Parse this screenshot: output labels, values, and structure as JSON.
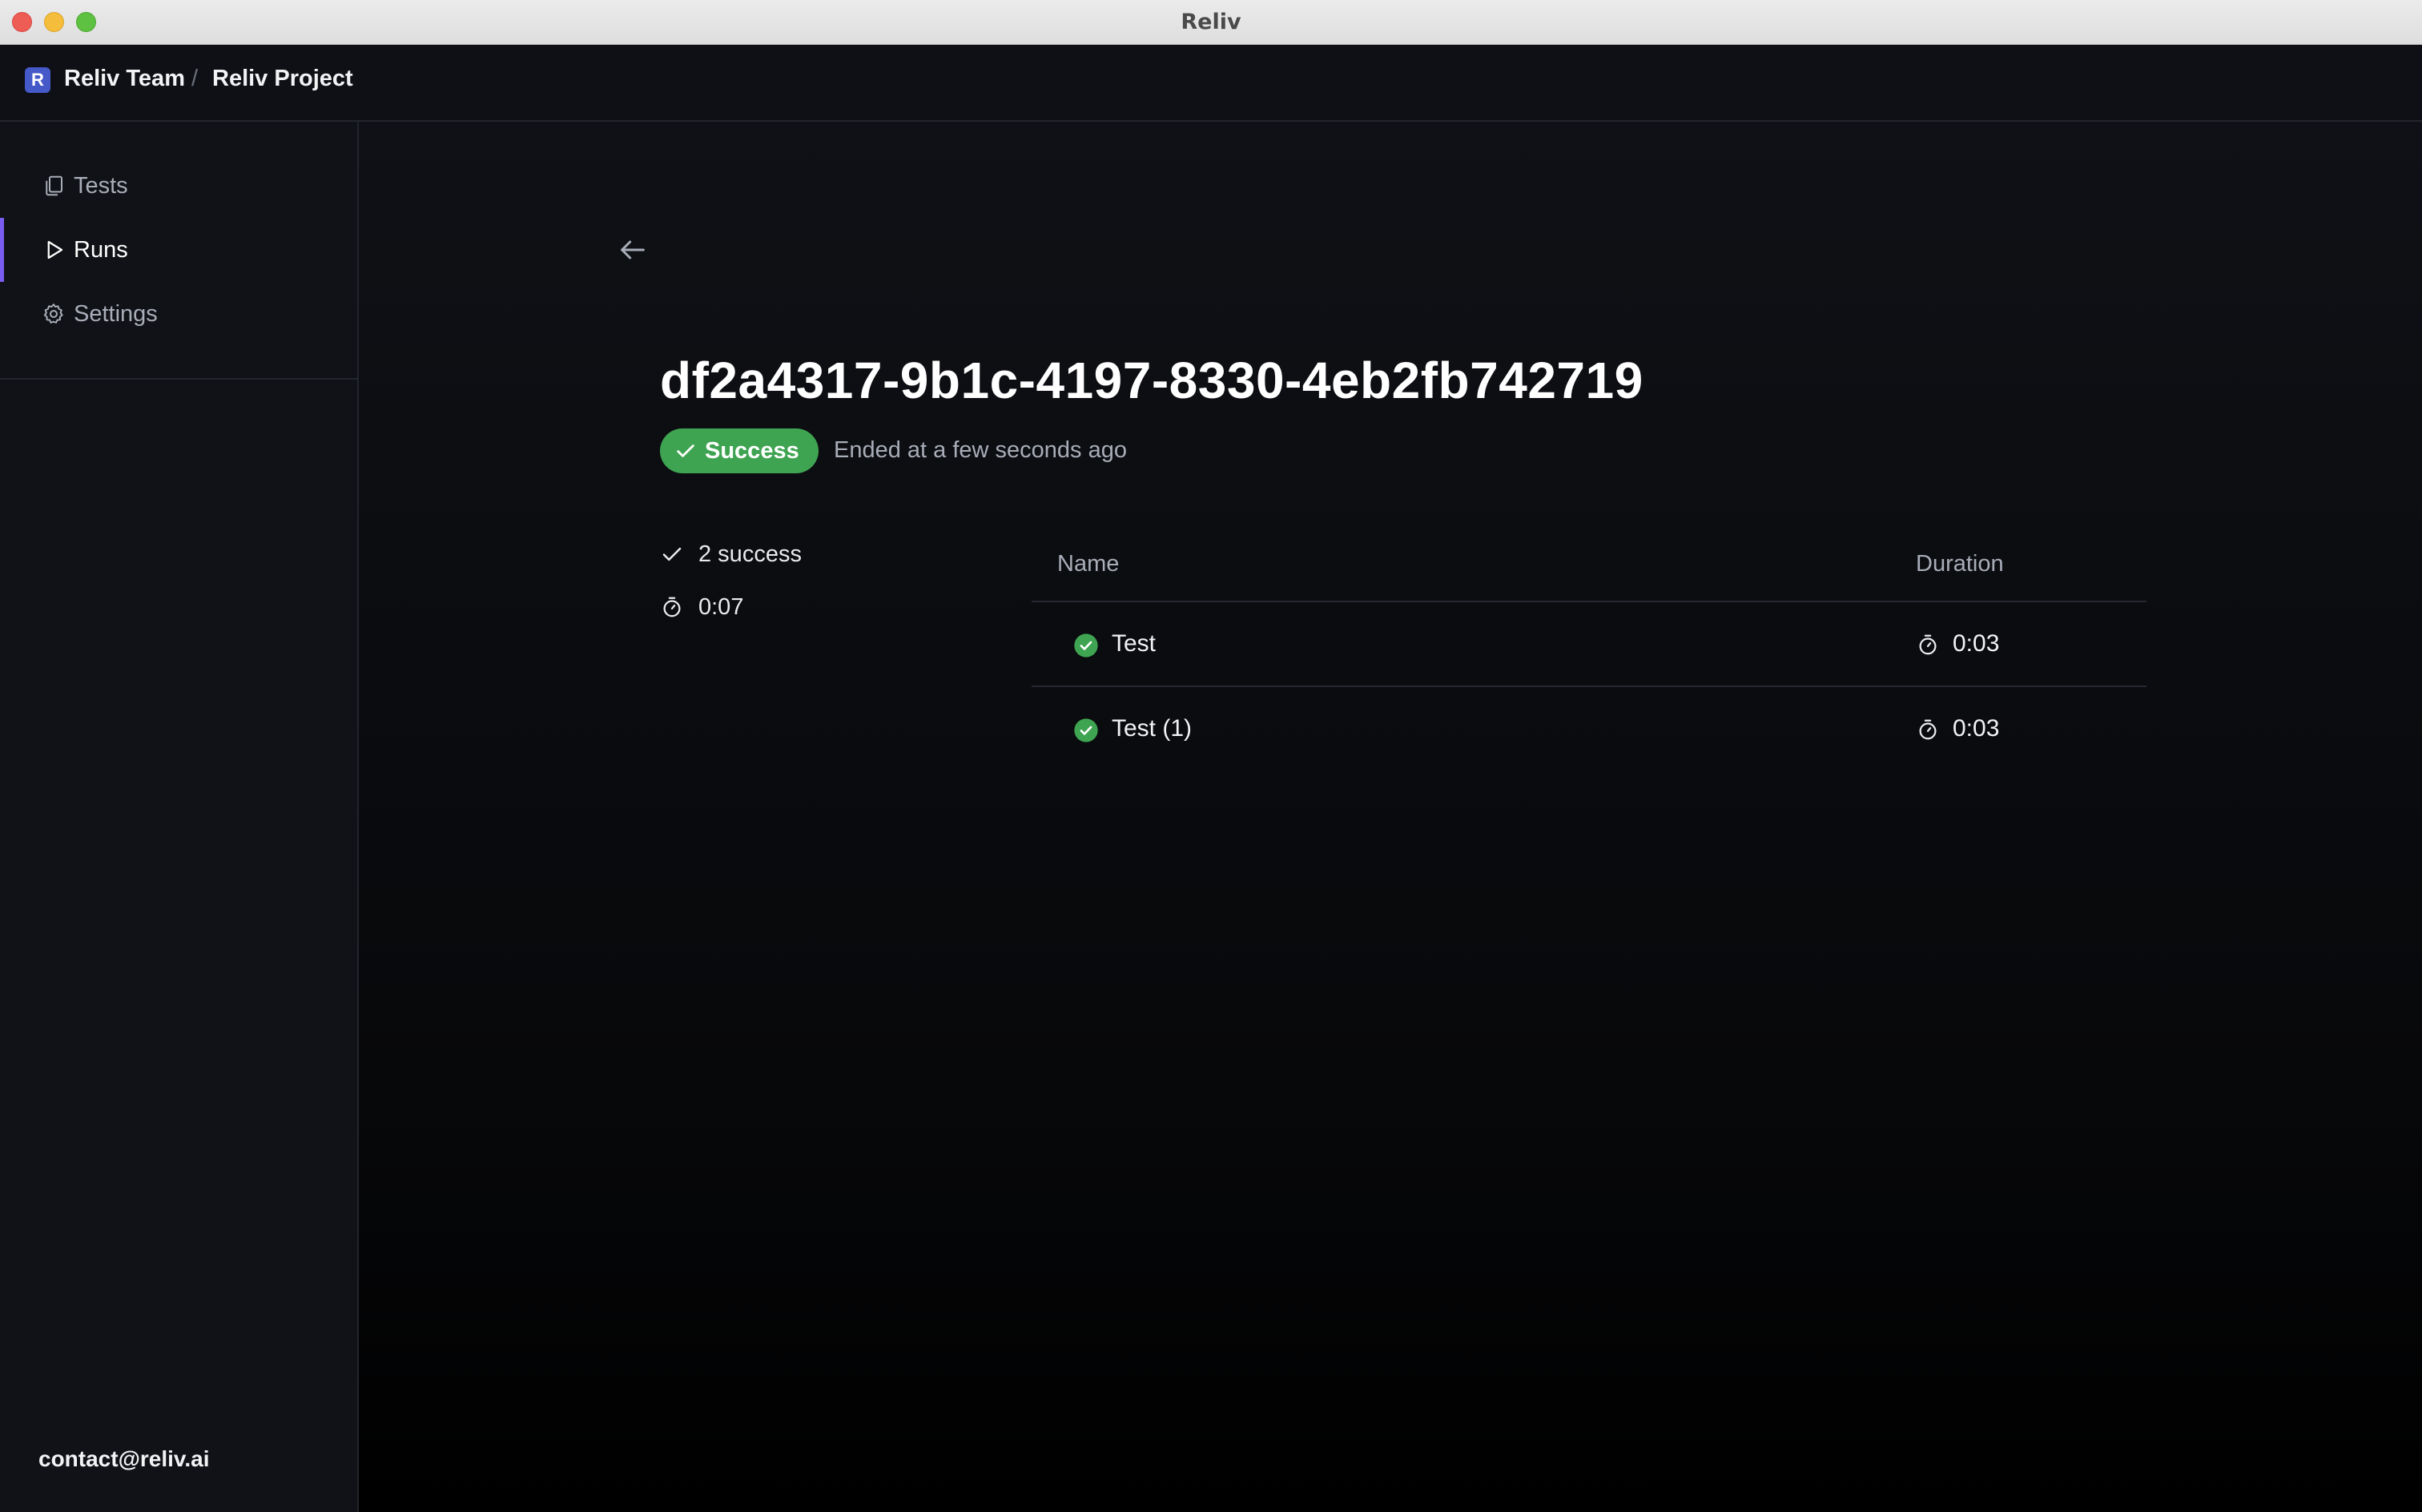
{
  "window": {
    "title": "Reliv"
  },
  "header": {
    "team_initial": "R",
    "team_name": "Reliv Team",
    "separator": "/",
    "project_name": "Reliv Project"
  },
  "sidebar": {
    "items": [
      {
        "label": "Tests",
        "icon": "copy-icon",
        "active": false
      },
      {
        "label": "Runs",
        "icon": "play-icon",
        "active": true
      },
      {
        "label": "Settings",
        "icon": "gear-icon",
        "active": false
      }
    ],
    "footer_email": "contact@reliv.ai"
  },
  "run": {
    "id": "df2a4317-9b1c-4197-8330-4eb2fb742719",
    "status": "Success",
    "ended_text": "Ended at a few seconds ago",
    "summary": {
      "success_text": "2 success",
      "total_duration": "0:07"
    },
    "table": {
      "columns": [
        "Name",
        "Duration"
      ],
      "rows": [
        {
          "name": "Test",
          "duration": "0:03",
          "status": "success"
        },
        {
          "name": "Test (1)",
          "duration": "0:03",
          "status": "success"
        }
      ]
    }
  },
  "colors": {
    "accent": "#7a5cf0",
    "success": "#3ea451",
    "team_logo": "#4659c9"
  }
}
